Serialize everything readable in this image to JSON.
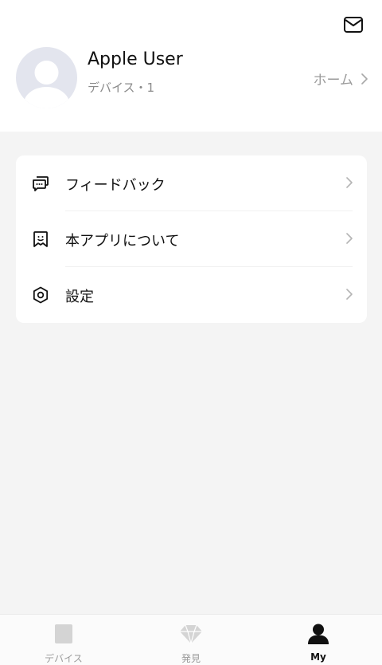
{
  "profile": {
    "name": "Apple User",
    "device_count": "デバイス・1",
    "home_link": "ホーム",
    "mail_icon": "mail-icon",
    "avatar_icon": "default-avatar-icon"
  },
  "menu": {
    "items": [
      {
        "label": "フィードバック",
        "icon": "feedback-chat-icon"
      },
      {
        "label": "本アプリについて",
        "icon": "about-app-icon"
      },
      {
        "label": "設定",
        "icon": "settings-hexagon-icon"
      }
    ]
  },
  "tabbar": {
    "items": [
      {
        "label": "デバイス",
        "icon": "device-square-icon",
        "active": false
      },
      {
        "label": "発見",
        "icon": "discover-diamond-icon",
        "active": false
      },
      {
        "label": "My",
        "icon": "user-profile-icon",
        "active": true
      }
    ]
  },
  "colors": {
    "background": "#f4f4f4",
    "card": "#ffffff",
    "primary_text": "#111111",
    "secondary_text": "#8a8a8a",
    "inactive_tab": "#9a9a9a",
    "avatar_bg": "#e3e5ee"
  }
}
